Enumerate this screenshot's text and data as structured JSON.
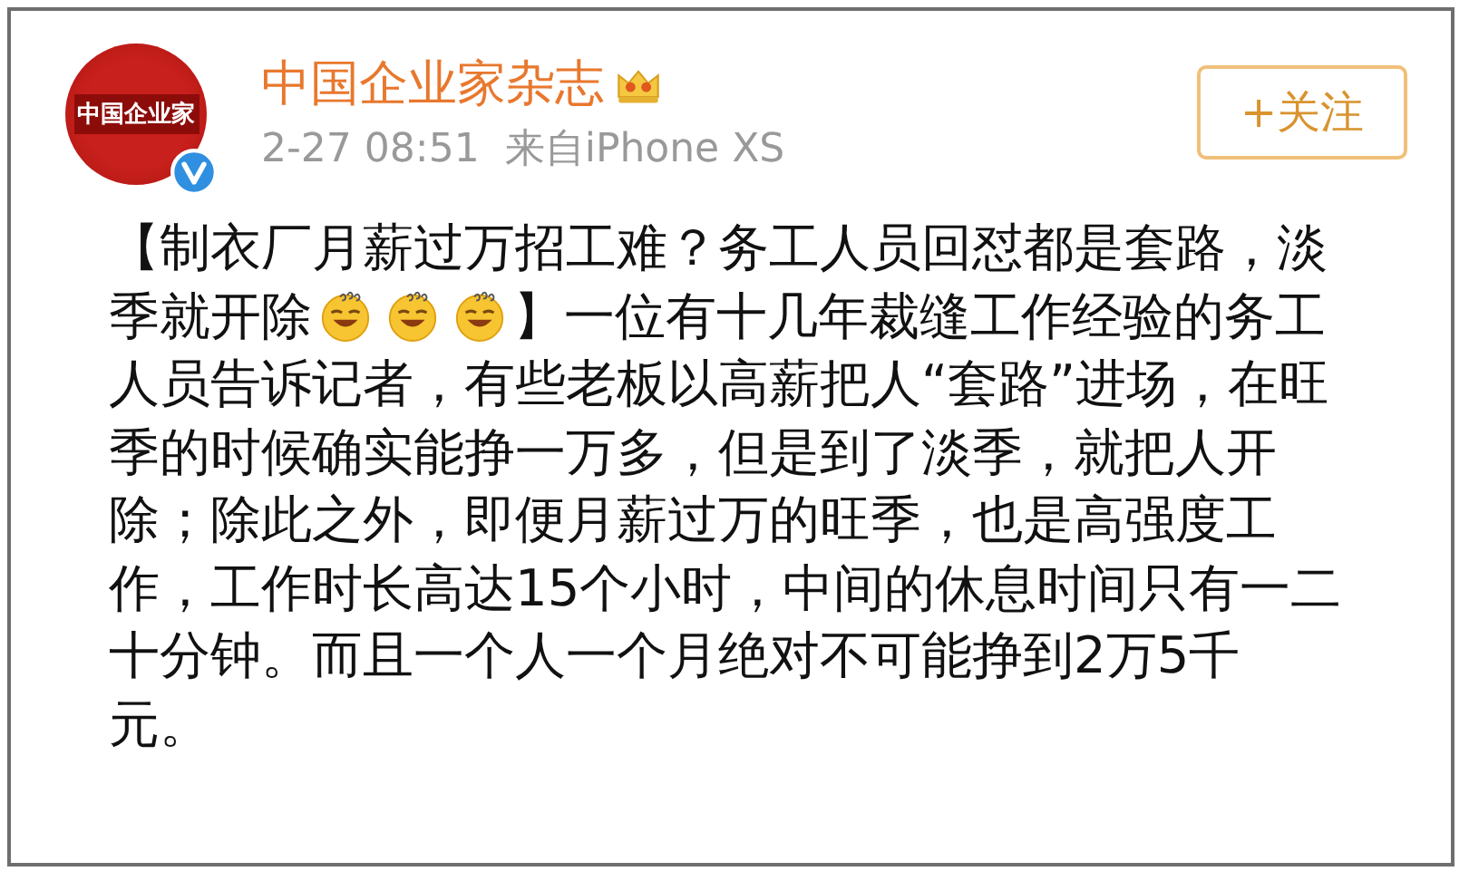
{
  "post": {
    "avatar_text": "中国企业家",
    "verified": true,
    "author": "中国企业家杂志",
    "author_badge": true,
    "time": "2-27 08:51",
    "source": "来自iPhone XS",
    "follow_button": "+关注",
    "lines": [
      [
        {
          "kind": "text",
          "text": "【制衣厂月薪过万招工难？务工人员回怼都是套路，淡"
        }
      ],
      [
        {
          "kind": "text",
          "text": "季就开除"
        },
        {
          "kind": "emoji"
        },
        {
          "kind": "emoji"
        },
        {
          "kind": "emoji"
        },
        {
          "kind": "text",
          "text": "】一位有十几年裁缝工作经验的务工"
        }
      ],
      [
        {
          "kind": "text",
          "text": "人员告诉记者，有些老板以高薪把人“套路”进场，在旺"
        }
      ],
      [
        {
          "kind": "text",
          "text": "季的时候确实能挣一万多，但是到了淡季，就把人开"
        }
      ],
      [
        {
          "kind": "text",
          "text": "除；除此之外，即便月薪过万的旺季，也是高强度工"
        }
      ],
      [
        {
          "kind": "text",
          "text": "作，工作时长高达15个小时，中间的休息时间只有一二"
        }
      ],
      [
        {
          "kind": "text",
          "text": "十分钟。而且一个人一个月绝对不可能挣到2万5千"
        }
      ],
      [
        {
          "kind": "text",
          "text": "元。"
        }
      ]
    ]
  }
}
